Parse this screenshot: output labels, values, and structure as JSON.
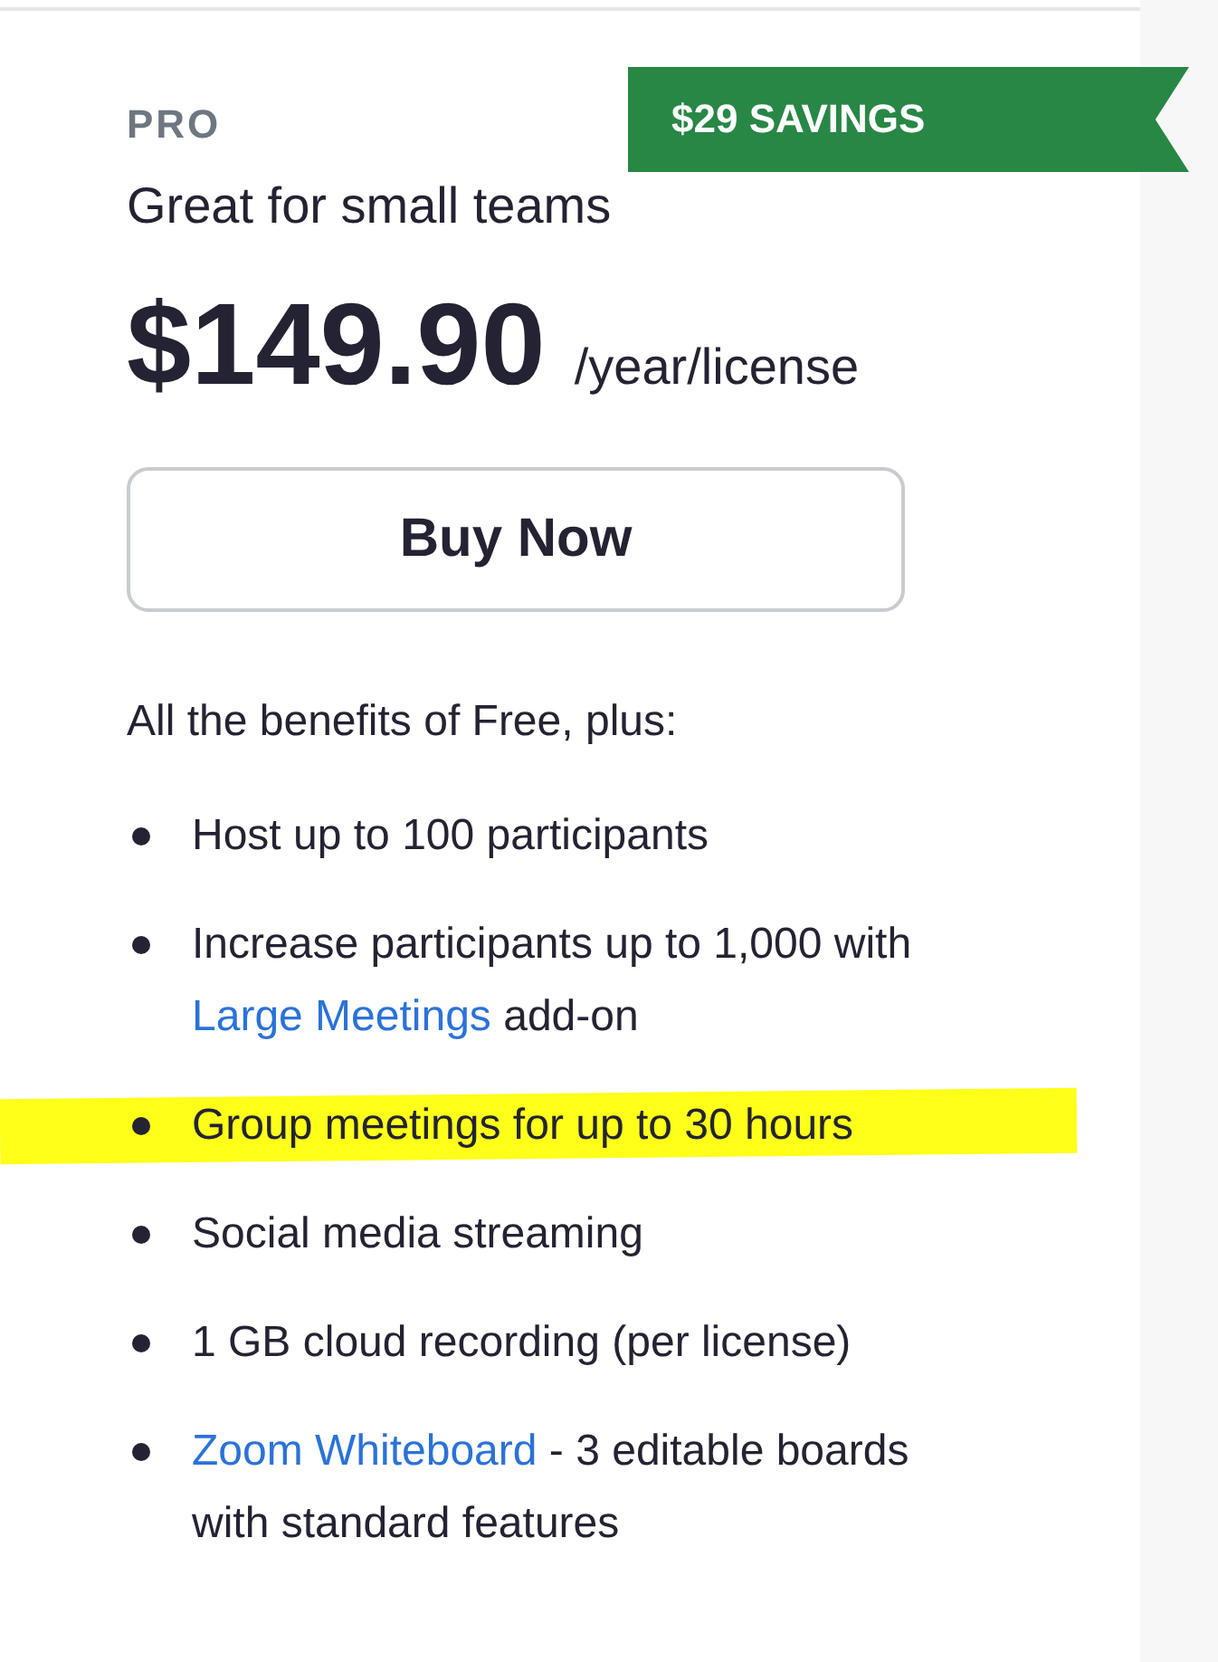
{
  "plan": {
    "name": "PRO",
    "ribbon": "$29 SAVINGS",
    "tagline": "Great for small teams",
    "price": "$149.90",
    "period": "/year/license",
    "button": "Buy Now",
    "intro": "All the benefits of Free, plus:"
  },
  "features": [
    {
      "highlighted": false,
      "parts": [
        {
          "kind": "text",
          "text": "Host up to 100 participants"
        }
      ]
    },
    {
      "highlighted": false,
      "parts": [
        {
          "kind": "text",
          "text": "Increase participants up to 1,000 with "
        },
        {
          "kind": "link",
          "text": "Large Meetings"
        },
        {
          "kind": "text",
          "text": " add-on"
        }
      ]
    },
    {
      "highlighted": true,
      "parts": [
        {
          "kind": "text",
          "text": "Group meetings for up to 30 hours"
        }
      ]
    },
    {
      "highlighted": false,
      "parts": [
        {
          "kind": "text",
          "text": "Social media streaming"
        }
      ]
    },
    {
      "highlighted": false,
      "parts": [
        {
          "kind": "text",
          "text": "1 GB cloud recording (per license)"
        }
      ]
    },
    {
      "highlighted": false,
      "parts": [
        {
          "kind": "link",
          "text": "Zoom Whiteboard"
        },
        {
          "kind": "text",
          "text": " - 3 editable boards with standard features"
        }
      ]
    }
  ]
}
